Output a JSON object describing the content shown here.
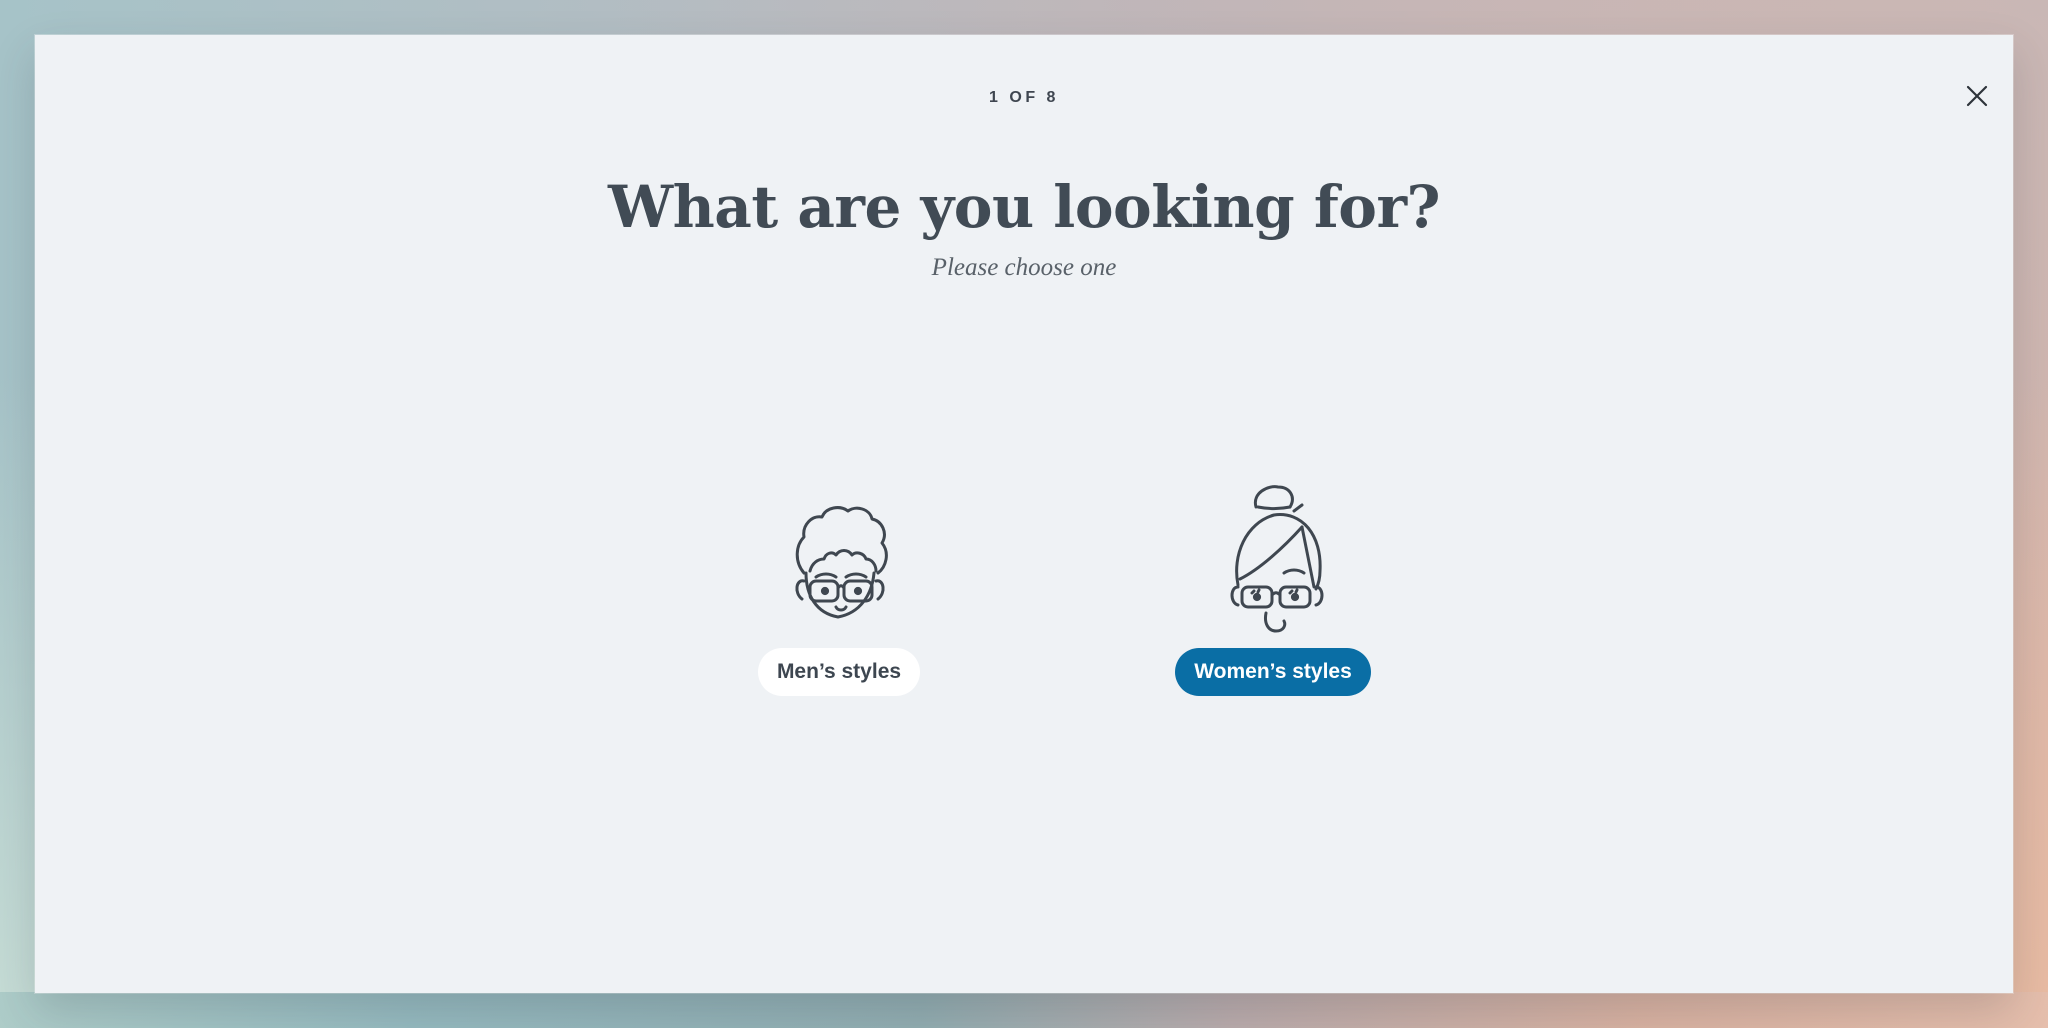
{
  "modal": {
    "progress": "1 OF 8",
    "title": "What are you looking for?",
    "subtitle": "Please choose one"
  },
  "options": [
    {
      "label": "Men’s styles",
      "icon": "man-with-glasses-icon",
      "selected": false
    },
    {
      "label": "Women’s styles",
      "icon": "woman-with-glasses-icon",
      "selected": true
    }
  ],
  "colors": {
    "modal_background": "#eff2f5",
    "text_dark": "#414b55",
    "primary_blue": "#0a6ea5",
    "button_white": "#ffffff",
    "illustration_stroke": "#3f4750"
  },
  "icons": {
    "close": "close-icon"
  }
}
